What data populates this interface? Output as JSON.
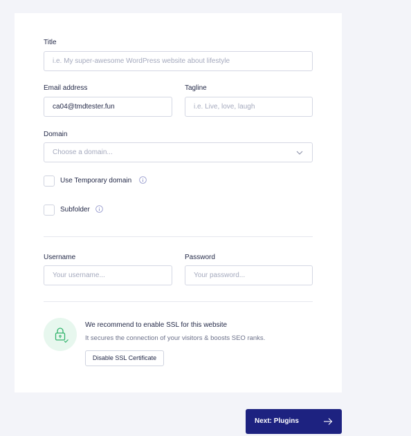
{
  "form": {
    "title": {
      "label": "Title",
      "placeholder": "i.e. My super-awesome WordPress website about lifestyle",
      "value": ""
    },
    "email": {
      "label": "Email address",
      "value": "ca04@tmdtester.fun"
    },
    "tagline": {
      "label": "Tagline",
      "placeholder": "i.e. Live, love, laugh",
      "value": ""
    },
    "domain": {
      "label": "Domain",
      "placeholder": "Choose a domain...",
      "icon": "chevron-down-icon"
    },
    "temporary_domain": {
      "label": "Use Temporary domain",
      "checked": false,
      "icon": "info-icon"
    },
    "subfolder": {
      "label": "Subfolder",
      "checked": false,
      "icon": "info-icon"
    },
    "username": {
      "label": "Username",
      "placeholder": "Your username...",
      "value": ""
    },
    "password": {
      "label": "Password",
      "placeholder": "Your password...",
      "value": ""
    }
  },
  "ssl": {
    "icon": "lock-check-icon",
    "title": "We recommend to enable SSL for this website",
    "text": "It secures the connection of your visitors & boosts SEO ranks.",
    "button_label": "Disable SSL Certificate"
  },
  "footer": {
    "next_label": "Next: Plugins",
    "next_icon": "arrow-right-icon"
  },
  "colors": {
    "background": "#f3f4f9",
    "primary": "#1d2280",
    "success": "#2fb36a",
    "ssl_circle": "#e7f7ee"
  }
}
